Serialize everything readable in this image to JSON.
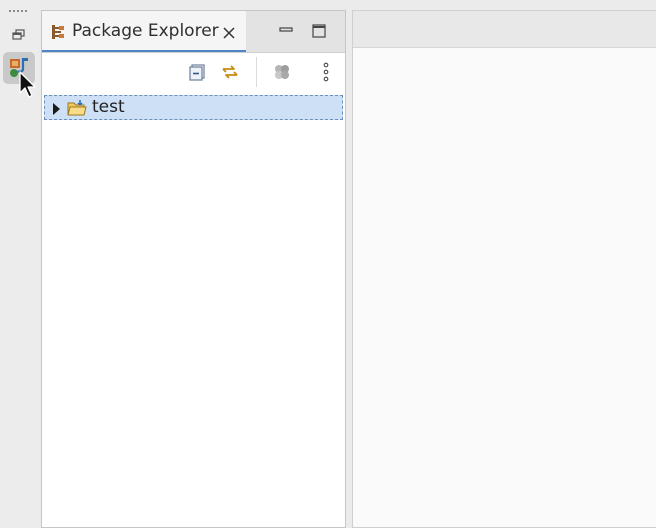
{
  "trim_bar": {
    "restore_icon": "restore-icon",
    "package_explorer_icon": "package-explorer-icon"
  },
  "view": {
    "tab": {
      "label": "Package Explorer",
      "icon": "package-explorer-icon",
      "close_icon": "close-icon"
    },
    "controls": {
      "minimize_icon": "minimize-icon",
      "maximize_icon": "maximize-icon"
    },
    "toolbar": {
      "items": [
        "collapse-all-icon",
        "link-with-editor-icon",
        "focus-on-active-task-icon",
        "view-menu-icon"
      ]
    },
    "tree": {
      "items": [
        {
          "label": "test",
          "icon": "project-folder-icon",
          "expanded": false,
          "selected": true
        }
      ]
    }
  },
  "colors": {
    "selection": "#cde0f5",
    "active_tab_underline": "#4f84c6"
  }
}
